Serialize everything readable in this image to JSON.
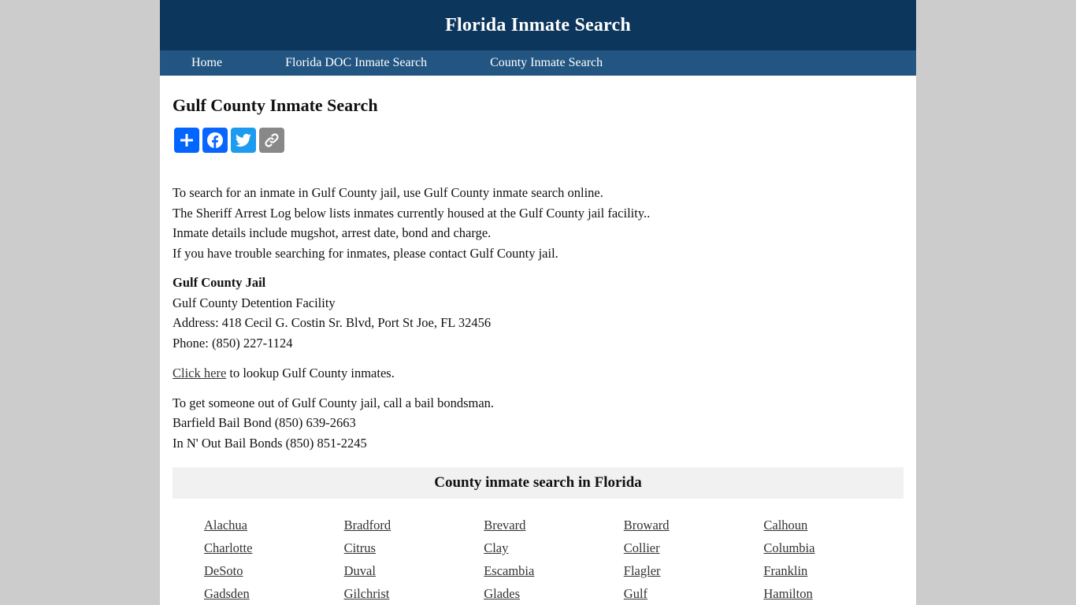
{
  "header": {
    "title": "Florida Inmate Search",
    "background_color": "#0c365c",
    "nav_color": "#225581"
  },
  "nav": {
    "items": [
      {
        "label": "Home"
      },
      {
        "label": "Florida DOC Inmate Search"
      },
      {
        "label": "County Inmate Search"
      }
    ]
  },
  "main": {
    "heading": "Gulf County Inmate Search",
    "share": {
      "buttons": [
        {
          "icon": "plus-icon",
          "label": "Share",
          "color": "#0166ff"
        },
        {
          "icon": "facebook-icon",
          "label": "Facebook",
          "color": "#0866ff"
        },
        {
          "icon": "twitter-icon",
          "label": "Twitter",
          "color": "#1d9bf0"
        },
        {
          "icon": "link-icon",
          "label": "Copy Link",
          "color": "#888888"
        }
      ]
    },
    "intro_lines": [
      "To search for an inmate in Gulf County jail, use Gulf County inmate search online.",
      "The Sheriff Arrest Log below lists inmates currently housed at the Gulf County jail facility..",
      "Inmate details include mugshot, arrest date, bond and charge.",
      "If you have trouble searching for inmates, please contact Gulf County jail."
    ],
    "jail": {
      "name": "Gulf County Jail",
      "facility": "Gulf County Detention Facility",
      "address": "Address: 418 Cecil G. Costin Sr. Blvd, Port St Joe, FL 32456",
      "phone": "Phone: (850) 227-1124"
    },
    "lookup": {
      "link_text": "Click here",
      "rest_text": " to lookup Gulf County inmates."
    },
    "bail": {
      "intro": "To get someone out of Gulf County jail, call a bail bondsman.",
      "bondsmen": [
        "Barfield Bail Bond (850) 639-2663",
        "In N' Out Bail Bonds (850) 851-2245"
      ]
    }
  },
  "counties": {
    "heading": "County inmate search in Florida",
    "items": [
      "Alachua",
      "Bradford",
      "Brevard",
      "Broward",
      "Calhoun",
      "Charlotte",
      "Citrus",
      "Clay",
      "Collier",
      "Columbia",
      "DeSoto",
      "Duval",
      "Escambia",
      "Flagler",
      "Franklin",
      "Gadsden",
      "Gilchrist",
      "Glades",
      "Gulf",
      "Hamilton"
    ]
  }
}
